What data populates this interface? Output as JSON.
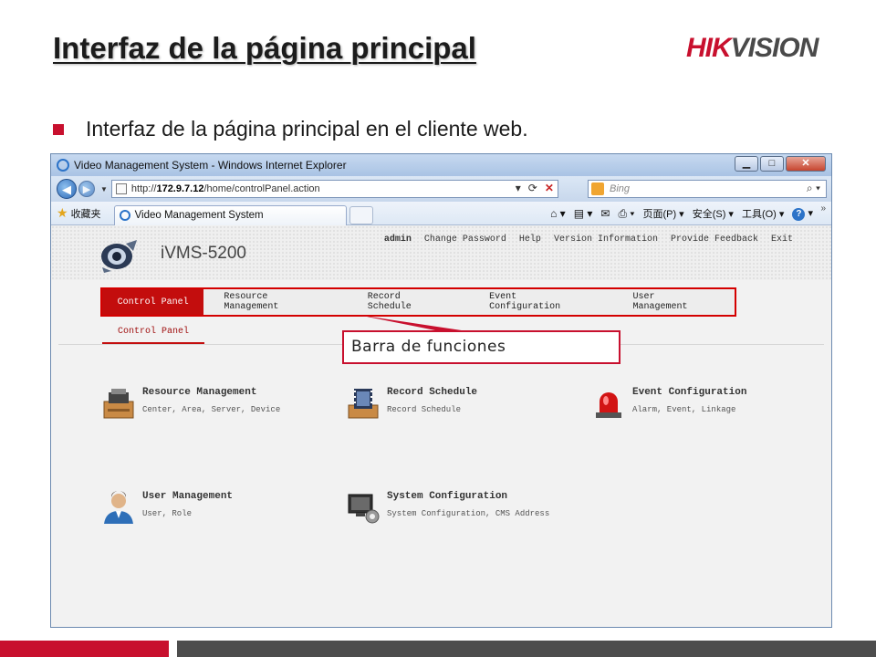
{
  "slide": {
    "title": "Interfaz de la página principal",
    "bullet": "Interfaz de la página principal en el cliente web.",
    "logo_hik": "HIK",
    "logo_vision": "VISION",
    "callout": "Barra de funciones"
  },
  "browser": {
    "window_title": "Video Management System - Windows Internet Explorer",
    "url_prefix": "http://",
    "url_host": "172.9.7.12",
    "url_path": "/home/controlPanel.action",
    "search_placeholder": "Bing",
    "favorites_label": "收藏夹",
    "tab_label": "Video Management System",
    "cmd_page": "页面(P)",
    "cmd_safety": "安全(S)",
    "cmd_tools": "工具(O)",
    "win_min": "▁",
    "win_max": "□",
    "win_close": "✕"
  },
  "app": {
    "name": "iVMS-5200",
    "top_links": [
      "admin",
      "Change Password",
      "Help",
      "Version Information",
      "Provide Feedback",
      "Exit"
    ],
    "menu": [
      "Control Panel",
      "Resource Management",
      "Record Schedule",
      "Event Configuration",
      "User Management"
    ],
    "active_menu": "Control Panel",
    "sub_tab": "Control Panel",
    "modules": [
      {
        "title": "Resource Management",
        "desc": "Center, Area, Server, Device",
        "icon": "printer-box-icon"
      },
      {
        "title": "Record Schedule",
        "desc": "Record Schedule",
        "icon": "film-box-icon"
      },
      {
        "title": "Event Configuration",
        "desc": "Alarm, Event, Linkage",
        "icon": "red-alarm-light-icon"
      },
      {
        "title": "User Management",
        "desc": "User, Role",
        "icon": "user-icon"
      },
      {
        "title": "System Configuration",
        "desc": "System Configuration, CMS Address",
        "icon": "monitor-gear-icon"
      }
    ]
  },
  "colors": {
    "accent_red": "#c8102e",
    "menu_active": "#c30d0d",
    "footer_grey": "#4d4d4d"
  }
}
